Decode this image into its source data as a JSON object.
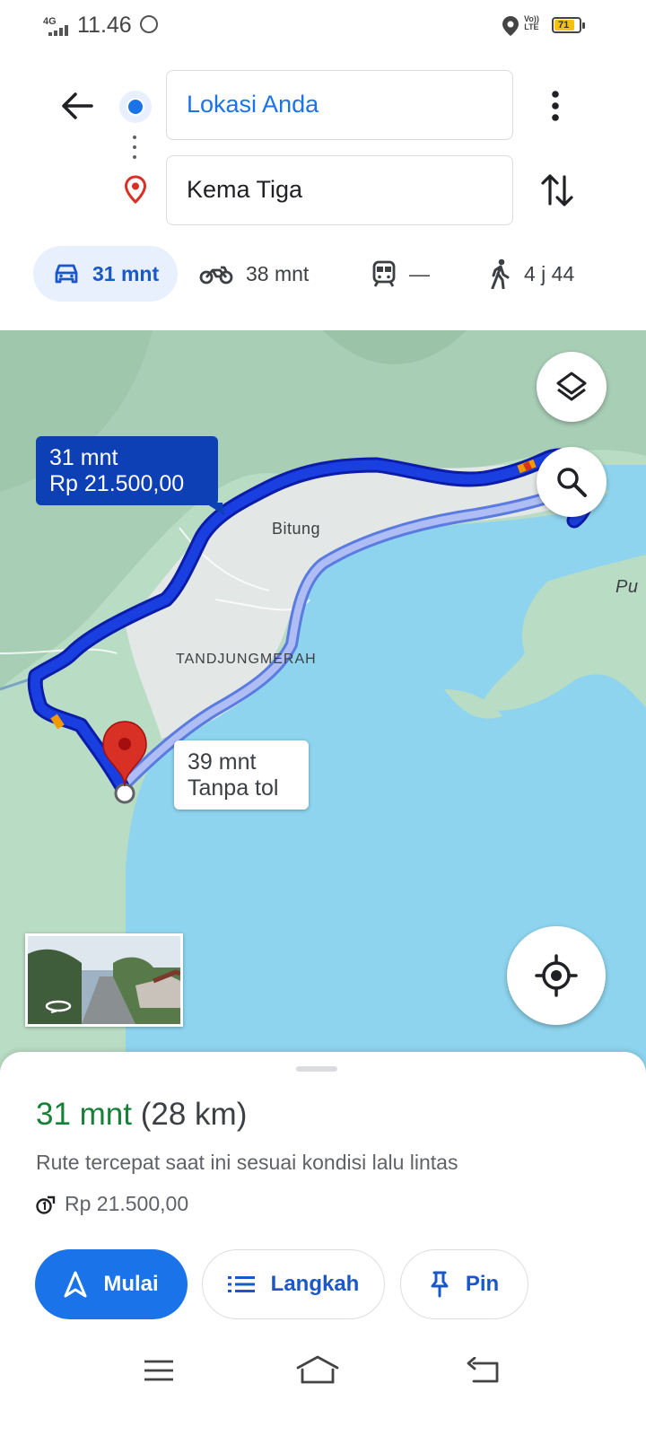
{
  "status_bar": {
    "network": "4G",
    "time": "11.46",
    "volte": "VoLTE",
    "battery": "71"
  },
  "directions": {
    "origin": "Lokasi Anda",
    "destination": "Kema Tiga"
  },
  "modes": [
    {
      "name": "car",
      "icon": "car-icon",
      "label": "31 mnt",
      "active": true
    },
    {
      "name": "motorcycle",
      "icon": "motorcycle-icon",
      "label": "38 mnt",
      "active": false
    },
    {
      "name": "transit",
      "icon": "train-icon",
      "label": "—",
      "active": false
    },
    {
      "name": "walk",
      "icon": "walk-icon",
      "label": "4 j 44",
      "active": false
    }
  ],
  "map": {
    "labels": {
      "city": "Bitung",
      "district": "TANDJUNGMERAH",
      "edge": "Pu"
    },
    "route_main": {
      "line1": "31 mnt",
      "line2": "Rp 21.500,00"
    },
    "route_alt": {
      "line1": "39 mnt",
      "line2": "Tanpa tol"
    },
    "colors": {
      "route": "#1a3fe0",
      "alt_route": "#8fa6ef",
      "water": "#8ed4ee",
      "land": "#b9dcc4",
      "pin": "#d93025"
    }
  },
  "sheet": {
    "duration": "31 mnt",
    "distance": "(28 km)",
    "description": "Rute tercepat saat ini sesuai kondisi lalu lintas",
    "toll": "Rp 21.500,00",
    "buttons": {
      "start": "Mulai",
      "steps": "Langkah",
      "pin": "Pin"
    }
  },
  "accent": "#1a73e8"
}
